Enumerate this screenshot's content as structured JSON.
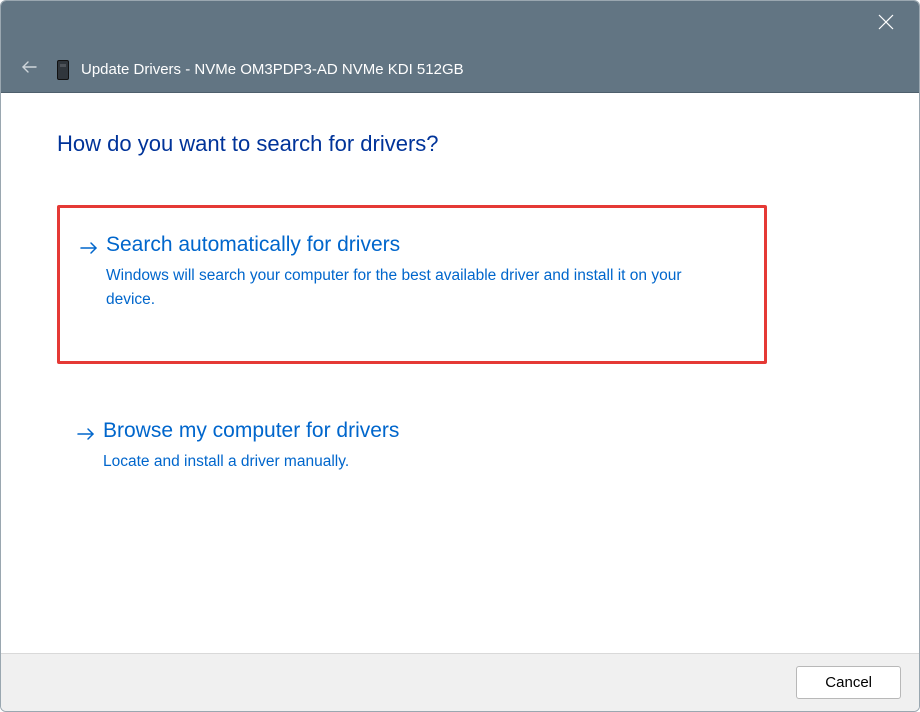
{
  "window": {
    "title": "Update Drivers - NVMe OM3PDP3-AD NVMe KDI 512GB"
  },
  "heading": "How do you want to search for drivers?",
  "options": [
    {
      "title": "Search automatically for drivers",
      "description": "Windows will search your computer for the best available driver and install it on your device.",
      "highlighted": true
    },
    {
      "title": "Browse my computer for drivers",
      "description": "Locate and install a driver manually.",
      "highlighted": false
    }
  ],
  "footer": {
    "cancel": "Cancel"
  },
  "icons": {
    "close": "close-icon",
    "back": "back-arrow-icon",
    "device": "disk-drive-icon",
    "arrow": "arrow-right-icon"
  }
}
